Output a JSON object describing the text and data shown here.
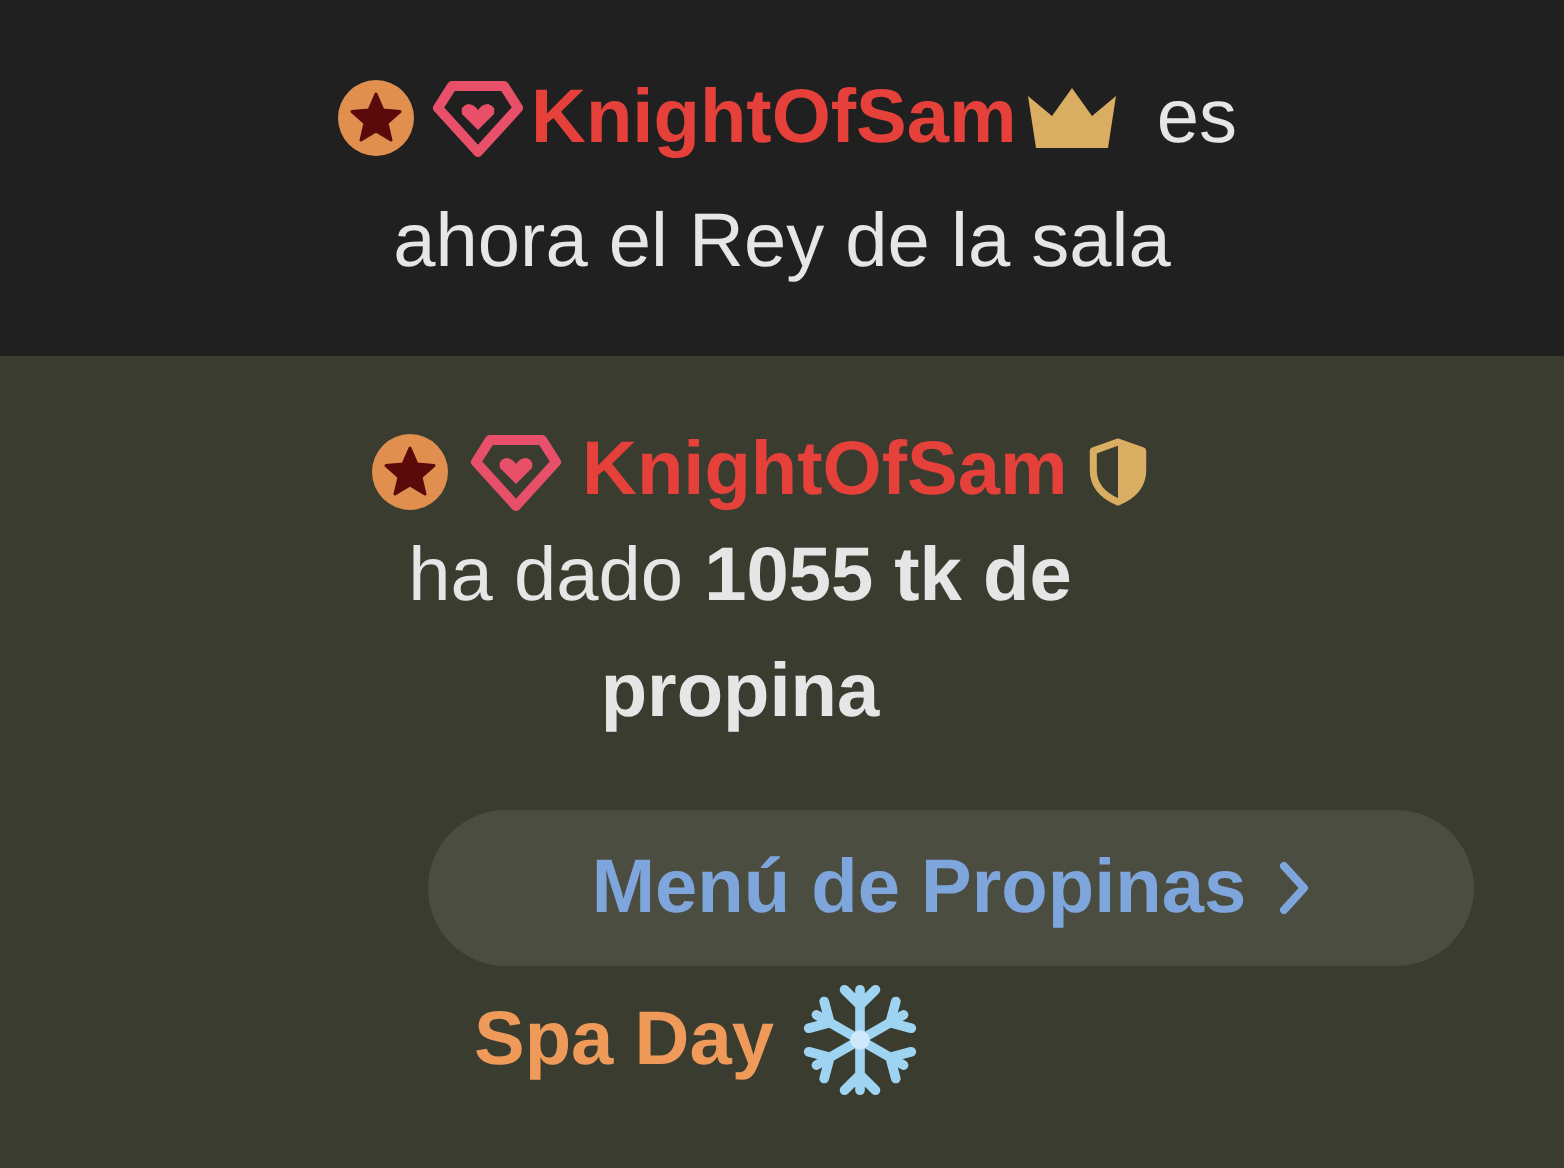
{
  "room_notice": {
    "username": "KnightOfSam",
    "badge": {
      "kind": "crown"
    },
    "text": [
      "es",
      "ahora el Rey de la sala"
    ]
  },
  "tip": {
    "username": "KnightOfSam",
    "badge": {
      "kind": "shield"
    },
    "text": "ha dado **1055 tk de propina**"
  },
  "tip_menu_button": {
    "label": "Menú de Propinas"
  },
  "tip_item": {
    "label": "Spa Day"
  }
}
